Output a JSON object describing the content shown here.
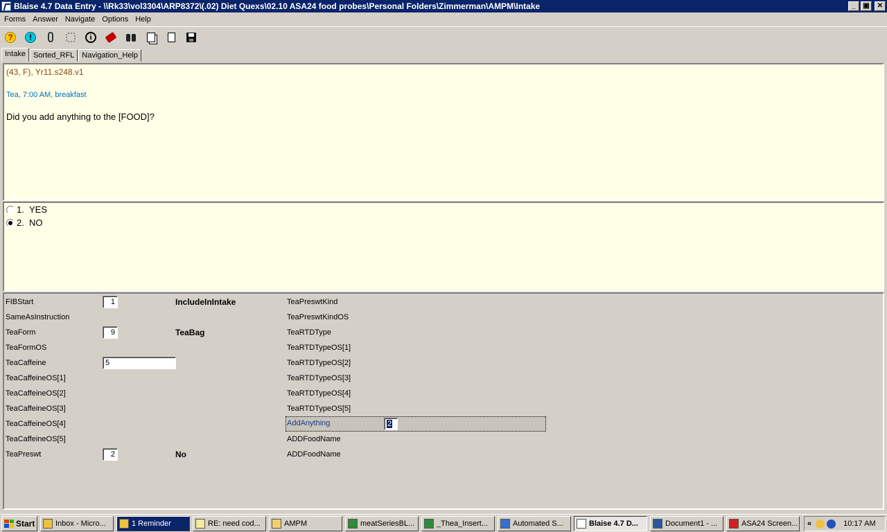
{
  "window": {
    "title": "Blaise 4.7 Data Entry - \\\\Rk33\\vol3304\\ARP8372\\(.02) Diet Quexs\\02.10 ASA24 food probes\\Personal Folders\\Zimmerman\\AMPM\\Intake",
    "minimize": "_",
    "maximize": "▣",
    "close": "✕"
  },
  "menu": [
    "Forms",
    "Answer",
    "Navigate",
    "Options",
    "Help"
  ],
  "tabs": [
    "Intake",
    "Sorted_RFL",
    "Navigation_Help"
  ],
  "question": {
    "meta": "(43, F),   Yr11.s248.v1",
    "meal": "Tea, 7:00 AM, breakfast",
    "text": "Did you add anything to the [FOOD]?"
  },
  "options": [
    {
      "num": "1.",
      "label": "YES",
      "checked": false
    },
    {
      "num": "2.",
      "label": "NO",
      "checked": true
    }
  ],
  "fields_left": [
    {
      "label": "FIBStart",
      "value": "1",
      "extra": "IncludeInIntake"
    },
    {
      "label": "SameAsInstruction",
      "value": "",
      "extra": ""
    },
    {
      "label": "TeaForm",
      "value": "9",
      "extra": "TeaBag"
    },
    {
      "label": "TeaFormOS",
      "value": "",
      "extra": ""
    },
    {
      "label": "TeaCaffeine",
      "value": "5",
      "extra": ""
    },
    {
      "label": "TeaCaffeineOS[1]",
      "value": "",
      "extra": ""
    },
    {
      "label": "TeaCaffeineOS[2]",
      "value": "",
      "extra": ""
    },
    {
      "label": "TeaCaffeineOS[3]",
      "value": "",
      "extra": ""
    },
    {
      "label": "TeaCaffeineOS[4]",
      "value": "",
      "extra": ""
    },
    {
      "label": "TeaCaffeineOS[5]",
      "value": "",
      "extra": ""
    },
    {
      "label": "TeaPreswt",
      "value": "2",
      "extra": "No"
    }
  ],
  "fields_right": [
    "TeaPreswtKind",
    "TeaPreswtKindOS",
    "TeaRTDType",
    "TeaRTDTypeOS[1]",
    "TeaRTDTypeOS[2]",
    "TeaRTDTypeOS[3]",
    "TeaRTDTypeOS[4]",
    "TeaRTDTypeOS[5]",
    "AddAnything",
    "ADDFoodName",
    "ADDFoodName"
  ],
  "focus_field": {
    "label": "AddAnything",
    "value": "2"
  },
  "taskbar": {
    "start": "Start",
    "tasks": [
      {
        "label": "Inbox - Micro...",
        "icon": "outlook-icon"
      },
      {
        "label": "1 Reminder",
        "icon": "bell-icon"
      },
      {
        "label": "RE: need cod...",
        "icon": "mail-icon"
      },
      {
        "label": "AMPM",
        "icon": "folder-icon"
      },
      {
        "label": "meatSeriesBL...",
        "icon": "excel-icon"
      },
      {
        "label": "_Thea_Insert...",
        "icon": "excel-icon"
      },
      {
        "label": "Automated S...",
        "icon": "browser-icon"
      },
      {
        "label": "Blaise 4.7 D...",
        "icon": "blaise-icon"
      },
      {
        "label": "Document1 - ...",
        "icon": "word-icon"
      },
      {
        "label": "ASA24 Screen...",
        "icon": "pdf-icon"
      }
    ],
    "tray_chevron": "«",
    "clock": "10:17 AM"
  }
}
